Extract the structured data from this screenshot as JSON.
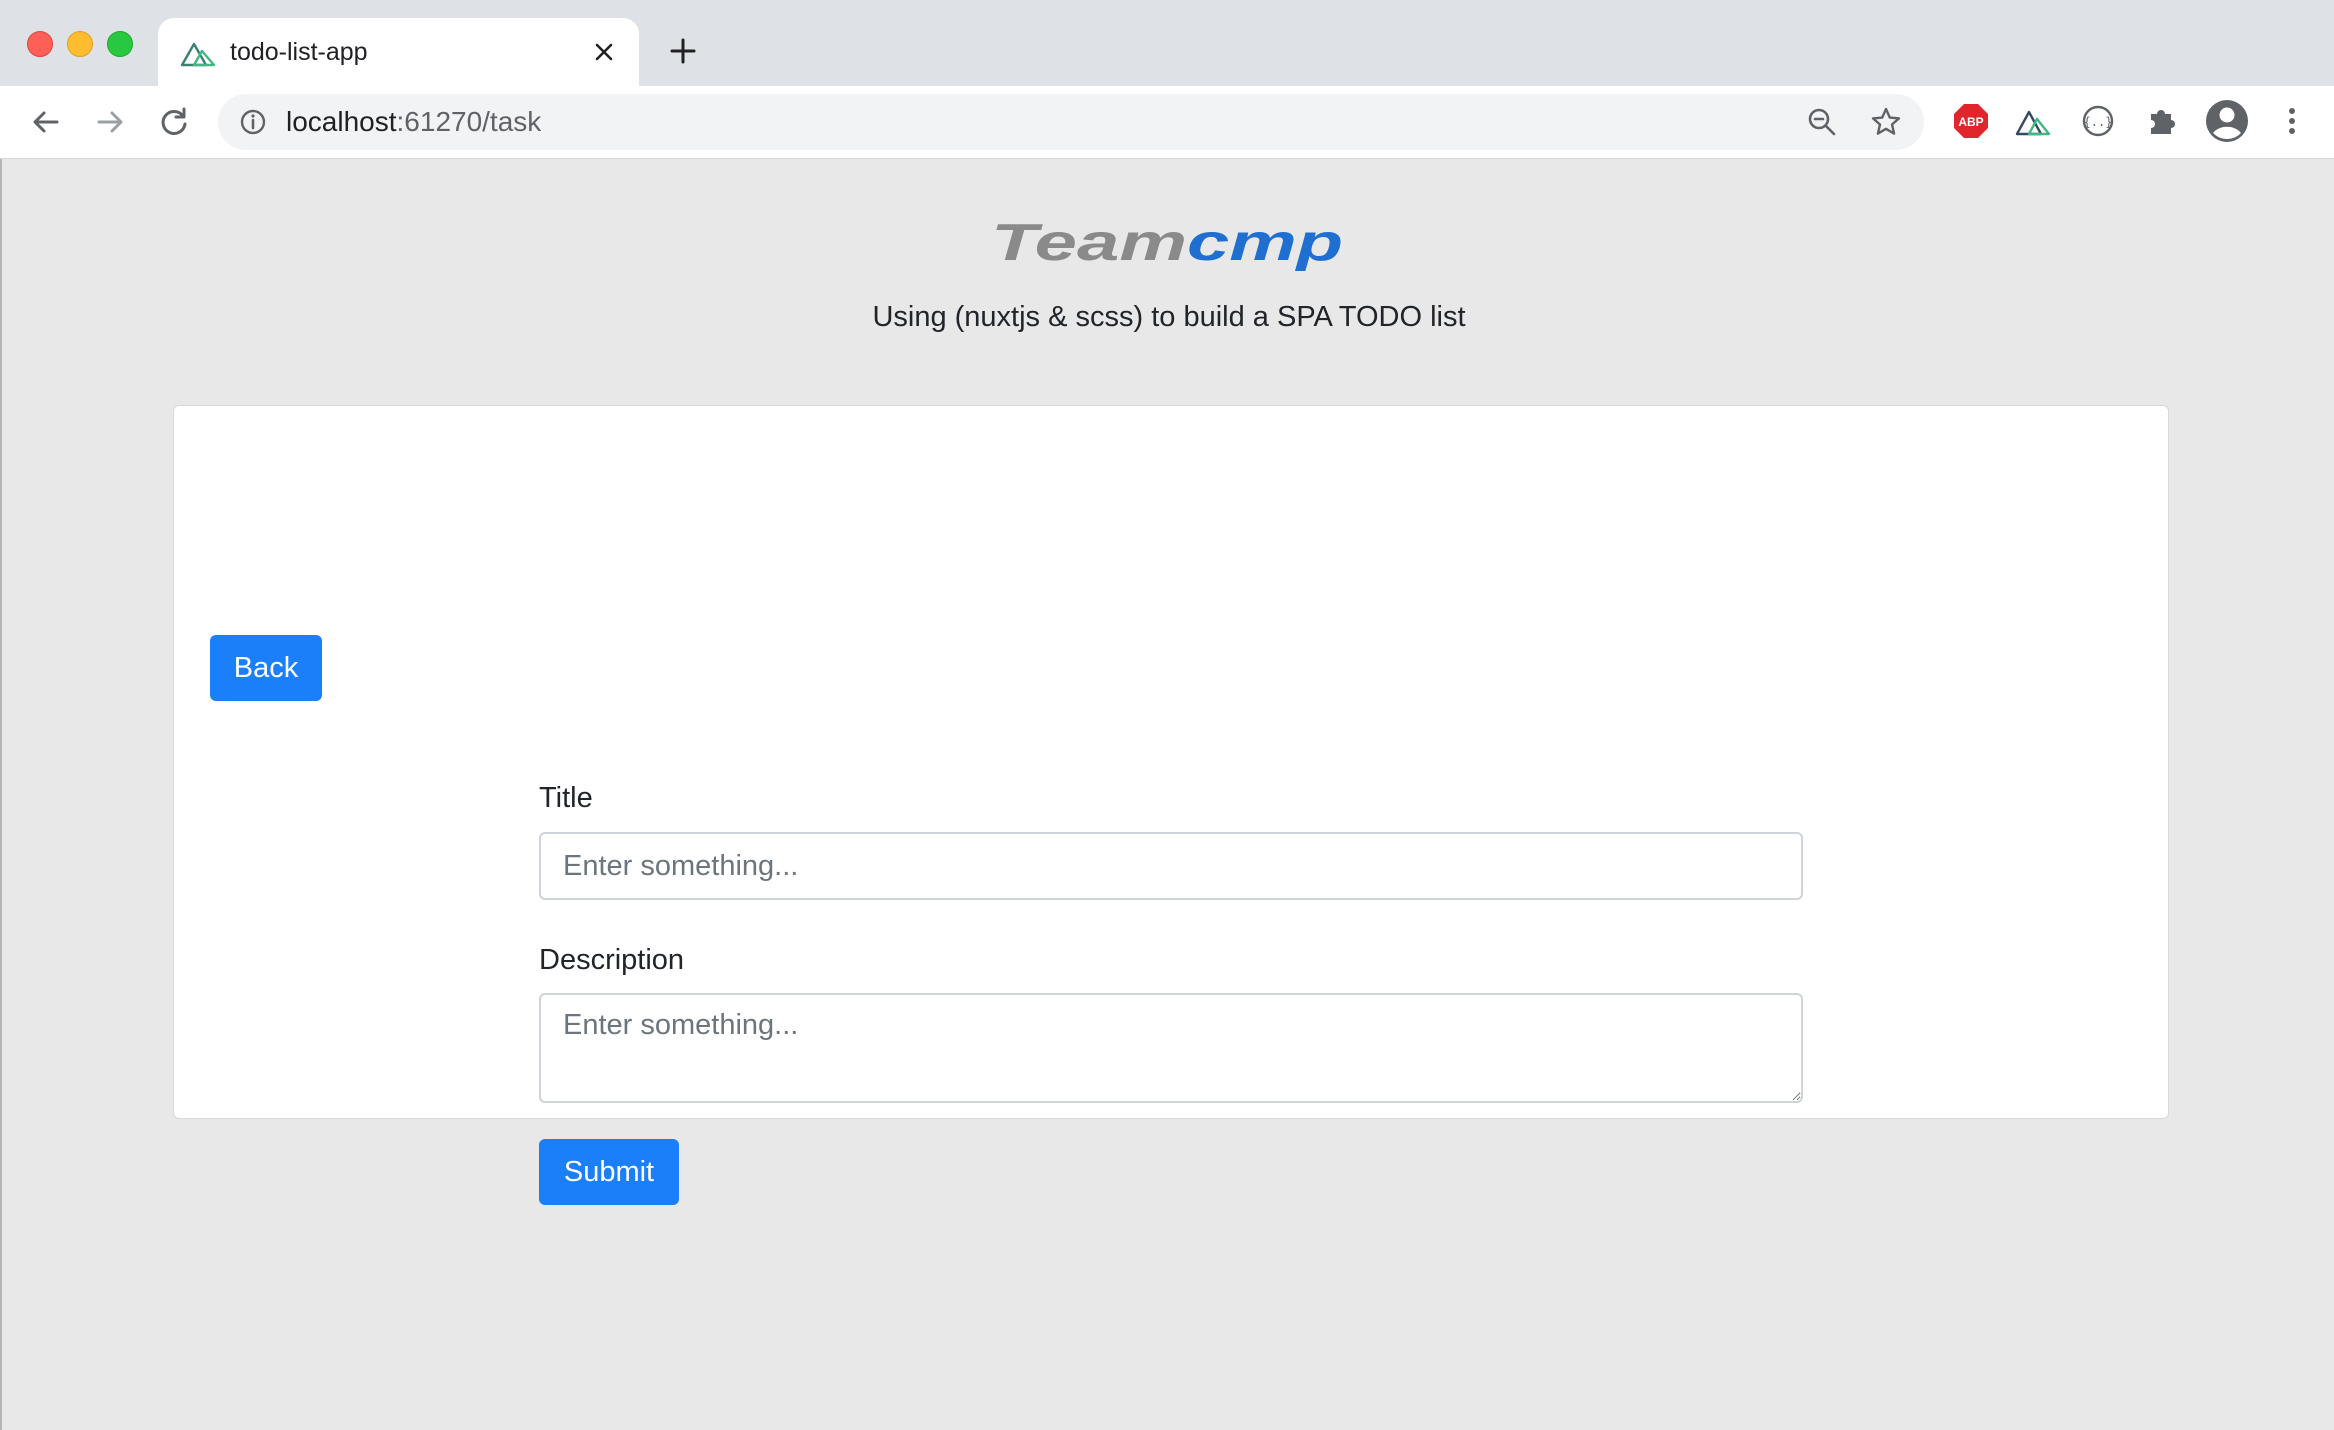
{
  "browser": {
    "tab_title": "todo-list-app",
    "url_host": "localhost",
    "url_rest": ":61270/task",
    "icons": [
      "back-arrow-icon",
      "forward-arrow-icon",
      "reload-icon",
      "site-info-icon",
      "zoom-out-icon",
      "bookmark-star-icon",
      "adblock-plus-icon",
      "nuxt-extension-icon",
      "json-extension-icon",
      "extensions-puzzle-icon",
      "profile-avatar-icon",
      "menu-dots-icon"
    ],
    "abp_text": "ABP"
  },
  "page": {
    "logo_text_gray": "Team",
    "logo_text_blue": "cmp",
    "subtitle": "Using (nuxtjs & scss) to build a SPA TODO list"
  },
  "form": {
    "back_label": "Back",
    "title_label": "Title",
    "title_placeholder": "Enter something...",
    "title_value": "",
    "description_label": "Description",
    "description_placeholder": "Enter something...",
    "description_value": "",
    "submit_label": "Submit"
  },
  "colors": {
    "primary": "#1a7ff9",
    "logo_gray": "#8a8a8a",
    "logo_blue": "#1f6fd1",
    "page_bg": "#e8e8e8"
  }
}
